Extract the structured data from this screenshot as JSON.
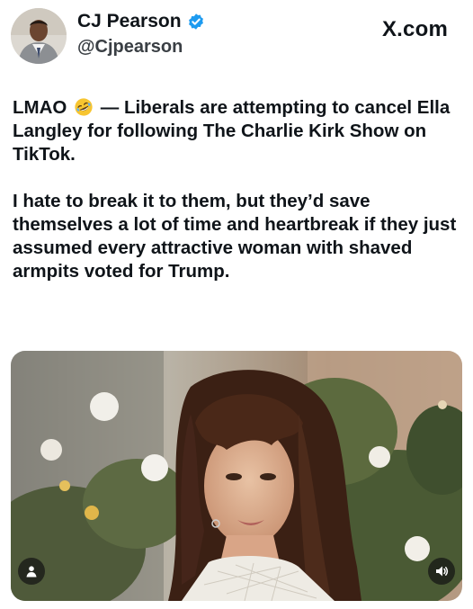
{
  "author": {
    "display_name": "CJ Pearson",
    "handle": "@Cjpearson",
    "verified": true,
    "avatar_icon": "profile-photo"
  },
  "source_label": "X.com",
  "tweet": {
    "paragraph1_start": "LMAO",
    "paragraph1_emoji": "rolling-on-floor-laughing-emoji",
    "paragraph1_rest": "— Liberals are attempting to cancel Ella Langley for following The Charlie Kirk Show on TikTok.",
    "paragraph2": "I hate to break it to them, but they’d save themselves a lot of time and heartbreak if they just assumed every attractive woman with shaved armpits voted for Trump."
  },
  "media": {
    "type": "video",
    "left_icon": "person-icon",
    "right_icon": "speaker-icon"
  },
  "colors": {
    "verified_blue": "#1d9bf0",
    "text": "#0f1419"
  }
}
